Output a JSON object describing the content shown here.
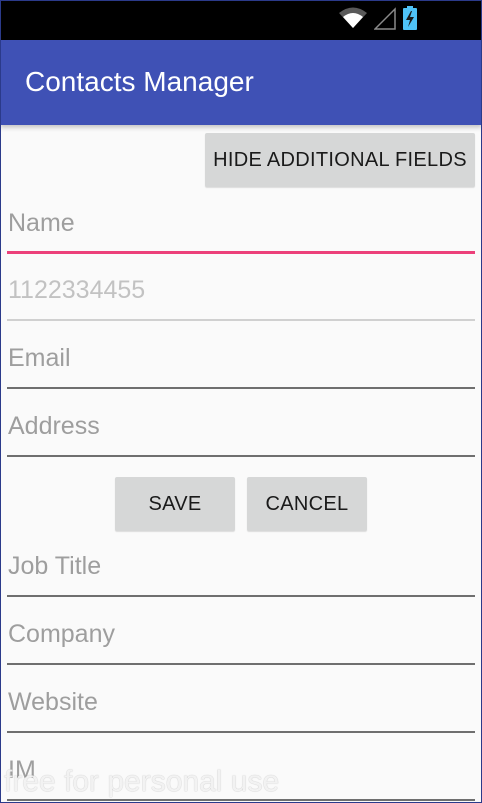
{
  "app": {
    "title": "Contacts Manager"
  },
  "status_bar": {
    "icons": [
      "wifi-icon",
      "signal-icon",
      "battery-icon"
    ]
  },
  "colors": {
    "toolbar": "#3f51b5",
    "status_bar": "#000000",
    "focus_accent": "#ec407a",
    "button_bg": "#d6d7d7"
  },
  "toggle_button": {
    "label": "HIDE ADDITIONAL FIELDS"
  },
  "fields": {
    "name": {
      "placeholder": "Name",
      "focused": true
    },
    "phone": {
      "value": "1122334455",
      "enabled": false
    },
    "email": {
      "placeholder": "Email"
    },
    "address": {
      "placeholder": "Address"
    },
    "job_title": {
      "placeholder": "Job Title"
    },
    "company": {
      "placeholder": "Company"
    },
    "website": {
      "placeholder": "Website"
    },
    "im": {
      "placeholder": "IM"
    }
  },
  "actions": {
    "save_label": "SAVE",
    "cancel_label": "CANCEL"
  },
  "watermark": "free for personal use"
}
